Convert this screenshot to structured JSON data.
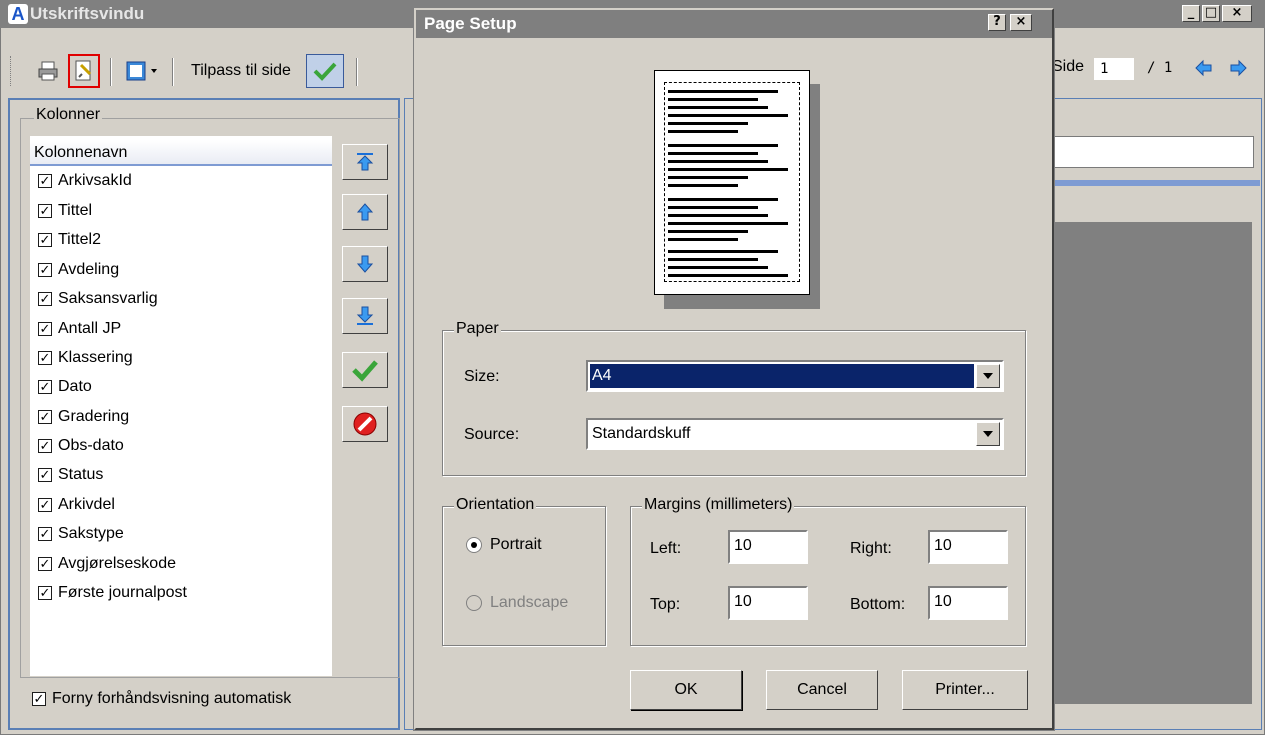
{
  "main_window": {
    "title": "Utskriftsvindu",
    "icon_letter": "A",
    "min_btn": "_",
    "max_btn": "□",
    "close_btn": "×"
  },
  "toolbar": {
    "fit_label": "Tilpass til side",
    "page_label": "Side",
    "page_value": "1",
    "page_total": "/ 1"
  },
  "kolonner": {
    "legend": "Kolonner",
    "header": "Kolonnenavn",
    "items": [
      "ArkivsakId",
      "Tittel",
      "Tittel2",
      "Avdeling",
      "Saksansvarlig",
      "Antall JP",
      "Klassering",
      "Dato",
      "Gradering",
      "Obs-dato",
      "Status",
      "Arkivdel",
      "Sakstype",
      "Avgjørelseskode",
      "Første journalpost"
    ],
    "auto_refresh": "Forny forhåndsvisning automatisk"
  },
  "dialog": {
    "title": "Page Setup",
    "help_btn": "?",
    "close_btn": "×",
    "paper": {
      "legend": "Paper",
      "size_label": "Size:",
      "size_value": "A4",
      "source_label": "Source:",
      "source_value": "Standardskuff"
    },
    "orientation": {
      "legend": "Orientation",
      "portrait": "Portrait",
      "landscape": "Landscape",
      "selected": "Portrait"
    },
    "margins": {
      "legend": "Margins (millimeters)",
      "left_label": "Left:",
      "left_value": "10",
      "right_label": "Right:",
      "right_value": "10",
      "top_label": "Top:",
      "top_value": "10",
      "bottom_label": "Bottom:",
      "bottom_value": "10"
    },
    "buttons": {
      "ok": "OK",
      "cancel": "Cancel",
      "printer": "Printer..."
    }
  },
  "colors": {
    "face": "#d4d0c8",
    "title_inactive": "#808080",
    "selection": "#0a246a",
    "accent_blue": "#1a6fd8",
    "check_green": "#3aa53a",
    "cancel_red": "#d01010"
  }
}
